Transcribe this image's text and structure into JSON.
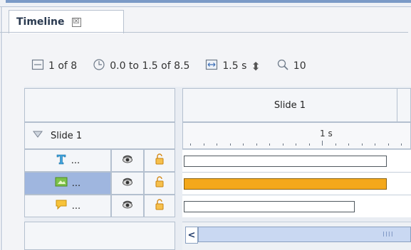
{
  "panel": {
    "tab_label": "Timeline",
    "tab_close_glyph": "☒"
  },
  "toolbar": {
    "slide_icon": "slide-frame-icon",
    "slide_counter": "1 of 8",
    "time_icon": "clock-icon",
    "time_range": "0.0 to 1.5 of 8.5",
    "duration_icon": "fit-width-icon",
    "duration": "1.5 s",
    "stepper_glyph": "⬍",
    "zoom_icon": "magnifier-icon",
    "zoom_partial": "10"
  },
  "grid": {
    "slide_row_label": "Slide 1",
    "timeline_header": "Slide 1",
    "ruler_label": "1 s",
    "rows": [
      {
        "type": "text",
        "label": "...",
        "icon": "text-object-icon",
        "visible_icon": "eye-icon",
        "lock_icon": "lock-icon",
        "selected": false,
        "bar_fraction": 0.95,
        "bar_color": "#ffffff"
      },
      {
        "type": "image",
        "label": "...",
        "icon": "image-object-icon",
        "visible_icon": "eye-icon",
        "lock_icon": "lock-icon",
        "selected": true,
        "bar_fraction": 0.95,
        "bar_color": "#f4a81b"
      },
      {
        "type": "caption",
        "label": "...",
        "icon": "caption-object-icon",
        "visible_icon": "eye-icon",
        "lock_icon": "lock-icon",
        "selected": false,
        "bar_fraction": 0.8,
        "bar_color": "#ffffff"
      }
    ],
    "scroll_left_glyph": "<",
    "scroll_grip_glyph": "IIII"
  },
  "colors": {
    "accent": "#7b9ac7",
    "selected_row": "#9fb6df",
    "bar_orange": "#f4a81b"
  }
}
